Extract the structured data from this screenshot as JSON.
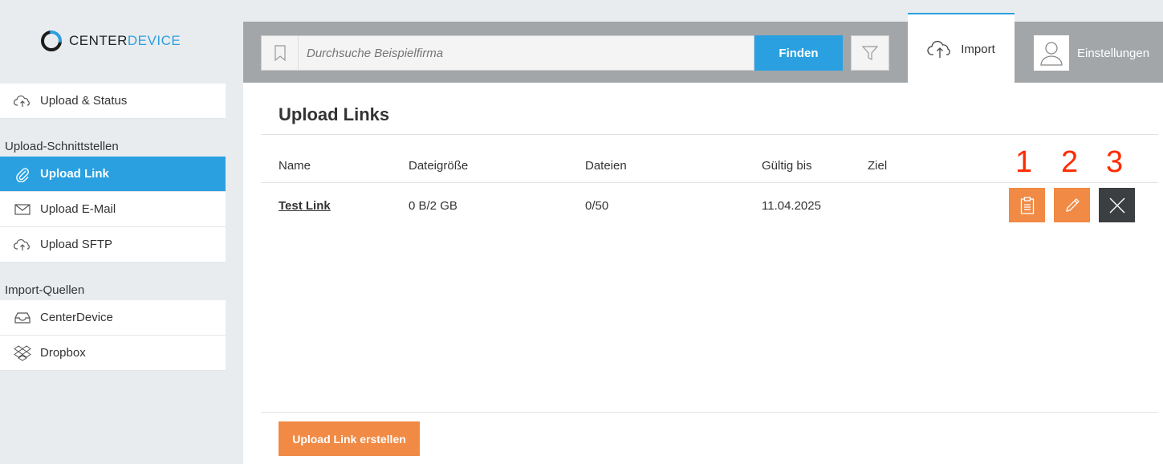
{
  "brand": {
    "name_part1": "CENTER",
    "name_part2": "DEVICE"
  },
  "sidebar": {
    "upload_status": {
      "label": "Upload & Status",
      "icon": "cloud-upload-icon"
    },
    "section1_heading": "Upload-Schnittstellen",
    "items1": [
      {
        "label": "Upload Link",
        "icon": "paperclip-icon",
        "active": true
      },
      {
        "label": "Upload E-Mail",
        "icon": "envelope-icon"
      },
      {
        "label": "Upload SFTP",
        "icon": "cloud-upload-icon"
      }
    ],
    "section2_heading": "Import-Quellen",
    "items2": [
      {
        "label": "CenterDevice",
        "icon": "inbox-icon"
      },
      {
        "label": "Dropbox",
        "icon": "dropbox-icon"
      }
    ]
  },
  "topbar": {
    "search_placeholder": "Durchsuche Beispielfirma",
    "find_label": "Finden",
    "import_tab": "Import",
    "settings_tab": "Einstellungen"
  },
  "main": {
    "title": "Upload Links",
    "columns": [
      "Name",
      "Dateigröße",
      "Dateien",
      "Gültig bis",
      "Ziel"
    ],
    "rows": [
      {
        "name": "Test Link",
        "size": "0 B/2 GB",
        "files": "0/50",
        "valid_until": "11.04.2025",
        "target": ""
      }
    ],
    "annotations": [
      "1",
      "2",
      "3"
    ],
    "create_button": "Upload Link erstellen"
  },
  "colors": {
    "accent_blue": "#2aa0e0",
    "action_orange": "#f08a44",
    "action_dark": "#3b3f41",
    "annotation_red": "#ff2a00"
  }
}
